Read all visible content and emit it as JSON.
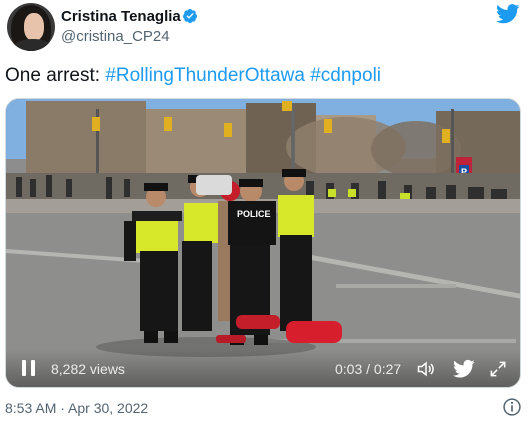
{
  "user": {
    "name": "Cristina Tenaglia",
    "handle": "@cristina_CP24"
  },
  "tweet": {
    "plain": "One arrest: ",
    "hashtags": [
      "#RollingThunderOttawa",
      "#cdnpoli"
    ]
  },
  "video": {
    "views": "8,282 views",
    "time": "0:03 / 0:27",
    "progress_fraction": 0.111,
    "scene_labels": {
      "police_vest": "POLICE",
      "parking_sign": "P"
    }
  },
  "meta": {
    "timestamp": "8:53 AM · Apr 30, 2022"
  },
  "icons": {
    "verified": "verified-badge-icon",
    "twitter": "twitter-bird-icon",
    "pause": "pause-icon",
    "volume": "volume-icon",
    "twitter_small": "twitter-bird-icon",
    "fullscreen": "fullscreen-icon",
    "info": "info-icon"
  },
  "colors": {
    "twitter_blue": "#1d9bf0",
    "text_primary": "#0f1419",
    "text_secondary": "#536471",
    "police_vest": "#d7e82a",
    "red_cloth": "#d61e2d"
  }
}
